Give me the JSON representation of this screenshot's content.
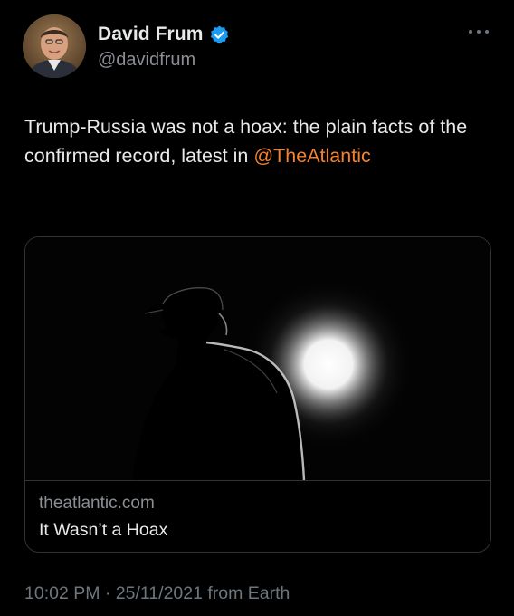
{
  "author": {
    "display_name": "David Frum",
    "handle": "@davidfrum",
    "verified": true
  },
  "tweet": {
    "text_before": "Trump-Russia was not a hoax: the plain facts of the confirmed record, latest in ",
    "mention": "@TheAtlantic"
  },
  "card": {
    "domain": "theatlantic.com",
    "title": "It Wasn’t a Hoax"
  },
  "meta": {
    "text": "10:02 PM · 25/11/2021 from Earth"
  },
  "icons": {
    "verified": "verified-badge-icon",
    "more": "more-options-icon"
  },
  "colors": {
    "background": "#000000",
    "text": "#e7e9ea",
    "secondary": "#8b8f94",
    "mention": "#f4812e",
    "verified": "#1d9bf0"
  }
}
